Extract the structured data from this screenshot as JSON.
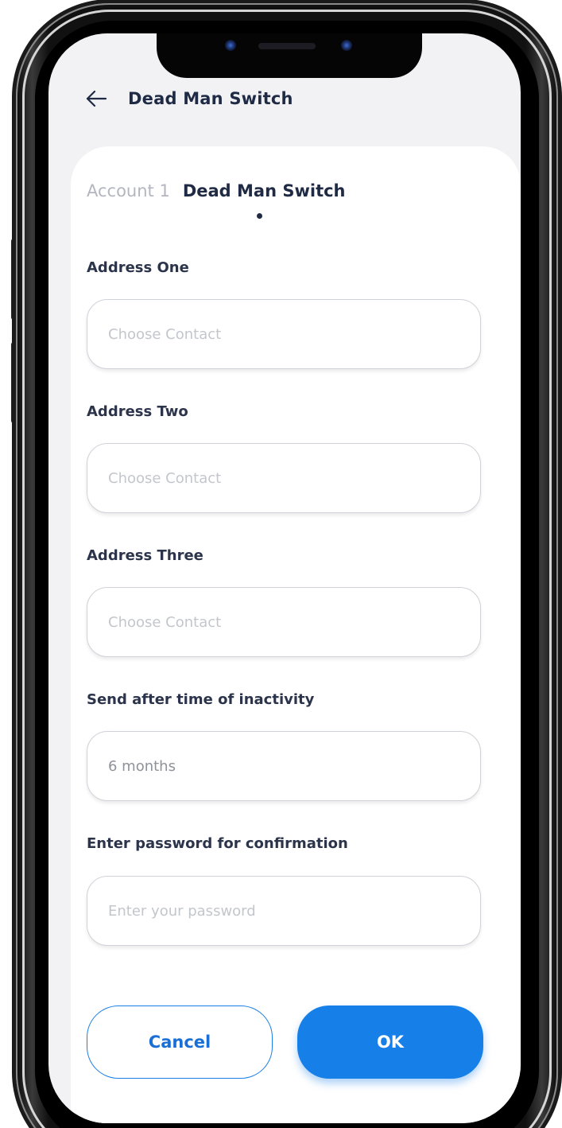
{
  "header": {
    "title": "Dead Man Switch",
    "back_icon": "arrow-left-icon"
  },
  "tabs": {
    "inactive": "Account 1",
    "active": "Dead Man Switch"
  },
  "fields": [
    {
      "label": "Address One",
      "placeholder": "Choose Contact",
      "value": ""
    },
    {
      "label": "Address Two",
      "placeholder": "Choose Contact",
      "value": ""
    },
    {
      "label": "Address Three",
      "placeholder": "Choose Contact",
      "value": ""
    },
    {
      "label": "Send after time of inactivity",
      "placeholder": "",
      "value": "6 months"
    },
    {
      "label": "Enter password for confirmation",
      "placeholder": "Enter your password",
      "value": ""
    }
  ],
  "buttons": {
    "cancel": "Cancel",
    "ok": "OK"
  },
  "colors": {
    "accent": "#167fe8",
    "title": "#1f2a44",
    "placeholder": "#c3c6cd"
  }
}
